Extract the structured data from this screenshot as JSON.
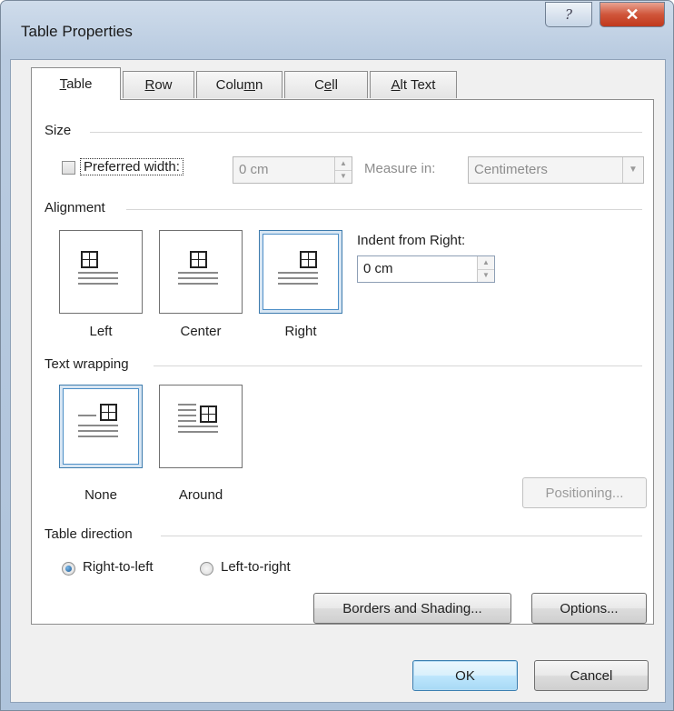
{
  "window": {
    "title": "Table Properties",
    "help_glyph": "?",
    "close_glyph": "✕"
  },
  "tabs": [
    {
      "label": "Table",
      "access_key_index": 0
    },
    {
      "label": "Row",
      "access_key_index": 0
    },
    {
      "label": "Column",
      "access_key_index": 4
    },
    {
      "label": "Cell",
      "access_key_index": 1
    },
    {
      "label": "Alt Text",
      "access_key_index": 0
    }
  ],
  "size": {
    "heading": "Size",
    "preferred_width_label": "Preferred width:",
    "preferred_width_checked": false,
    "width_value": "0 cm",
    "measure_label": "Measure in:",
    "measure_value": "Centimeters"
  },
  "alignment": {
    "heading": "Alignment",
    "options": [
      "Left",
      "Center",
      "Right"
    ],
    "selected": "Right",
    "indent_label": "Indent from Right:",
    "indent_value": "0 cm"
  },
  "text_wrapping": {
    "heading": "Text wrapping",
    "options": [
      "None",
      "Around"
    ],
    "selected": "None",
    "positioning_button": "Positioning..."
  },
  "table_direction": {
    "heading": "Table direction",
    "options": [
      "Right-to-left",
      "Left-to-right"
    ],
    "selected": "Right-to-left"
  },
  "buttons": {
    "borders_shading": "Borders and Shading...",
    "options": "Options...",
    "ok": "OK",
    "cancel": "Cancel"
  },
  "colors": {
    "accent": "#4d8fc7",
    "title_bar": "#b9cbe0",
    "close_red": "#c0381c",
    "dialog_bg": "#f0f0f0"
  },
  "icons": [
    "help-icon",
    "close-icon",
    "table-grid-icon",
    "spin-up-icon",
    "spin-down-icon",
    "dropdown-arrow-icon"
  ]
}
